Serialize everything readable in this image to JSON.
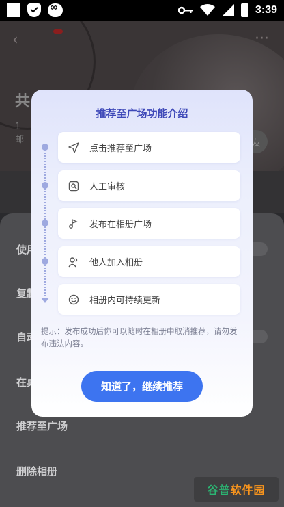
{
  "status_bar": {
    "time": "3:39",
    "left_icons": [
      "app-icon",
      "shield-check-icon",
      "infinity-app-icon"
    ],
    "right_icons": [
      "key-icon",
      "wifi-icon",
      "signal-icon",
      "battery-charging-icon"
    ]
  },
  "background": {
    "title_fragment": "共",
    "subtitle_fragments": [
      "1",
      "邮"
    ],
    "button_fragment": "友",
    "menu_items": [
      {
        "label": "使用",
        "has_toggle": true
      },
      {
        "label": "复制",
        "has_toggle": false
      },
      {
        "label": "自动",
        "has_toggle": true
      },
      {
        "label": "在桌",
        "has_toggle": false
      },
      {
        "label": "推荐至广场",
        "has_toggle": false
      },
      {
        "label": "删除相册",
        "has_toggle": false
      }
    ]
  },
  "dialog": {
    "title": "推荐至广场功能介绍",
    "steps": [
      {
        "label": "点击推荐至广场",
        "icon": "send-icon"
      },
      {
        "label": "人工审核",
        "icon": "review-icon"
      },
      {
        "label": "发布在相册广场",
        "icon": "music-note-icon"
      },
      {
        "label": "他人加入相册",
        "icon": "users-icon"
      },
      {
        "label": "相册内可持续更新",
        "icon": "smile-icon"
      }
    ],
    "tip": "提示：发布成功后你可以随时在相册中取消推荐，请勿发布违法内容。",
    "confirm_button": "知道了，继续推荐"
  },
  "watermark": {
    "part1": "谷普",
    "part2": "软件园"
  },
  "colors": {
    "accent": "#3d74f0",
    "title": "#3d48b8",
    "timeline": "#9ea9e0"
  }
}
